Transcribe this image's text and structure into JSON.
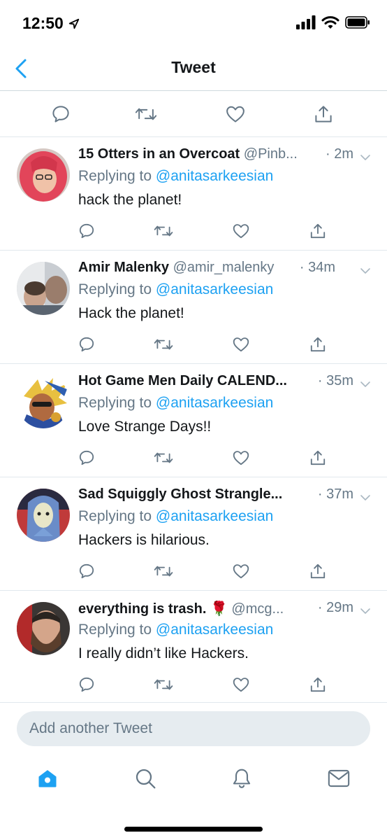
{
  "status_bar": {
    "time": "12:50"
  },
  "nav": {
    "title": "Tweet"
  },
  "compose": {
    "placeholder": "Add another Tweet"
  },
  "colors": {
    "accent": "#1da1f2",
    "secondary_text": "#657786",
    "divider": "#e1e8ed"
  },
  "replies": [
    {
      "name": "15 Otters in an Overcoat",
      "handle": "@Pinb...",
      "time": "· 2m",
      "reply_prefix": "Replying to",
      "mention": "@anitasarkeesian",
      "text": "hack the planet!"
    },
    {
      "name": "Amir Malenky",
      "handle": "@amir_malenky",
      "time": "· 34m",
      "reply_prefix": "Replying to",
      "mention": "@anitasarkeesian",
      "text": "Hack the planet!"
    },
    {
      "name": "Hot Game Men Daily CALEND...",
      "handle": "",
      "time": "· 35m",
      "reply_prefix": "Replying to",
      "mention": "@anitasarkeesian",
      "text": "Love Strange Days!!"
    },
    {
      "name": "Sad Squiggly Ghost Strangle...",
      "handle": "",
      "time": "· 37m",
      "reply_prefix": "Replying to",
      "mention": "@anitasarkeesian",
      "text": "Hackers is hilarious."
    },
    {
      "name": "everything is trash. 🌹",
      "handle": "@mcg...",
      "time": "· 29m",
      "reply_prefix": "Replying to",
      "mention": "@anitasarkeesian",
      "text": "I really didn’t like Hackers."
    }
  ]
}
